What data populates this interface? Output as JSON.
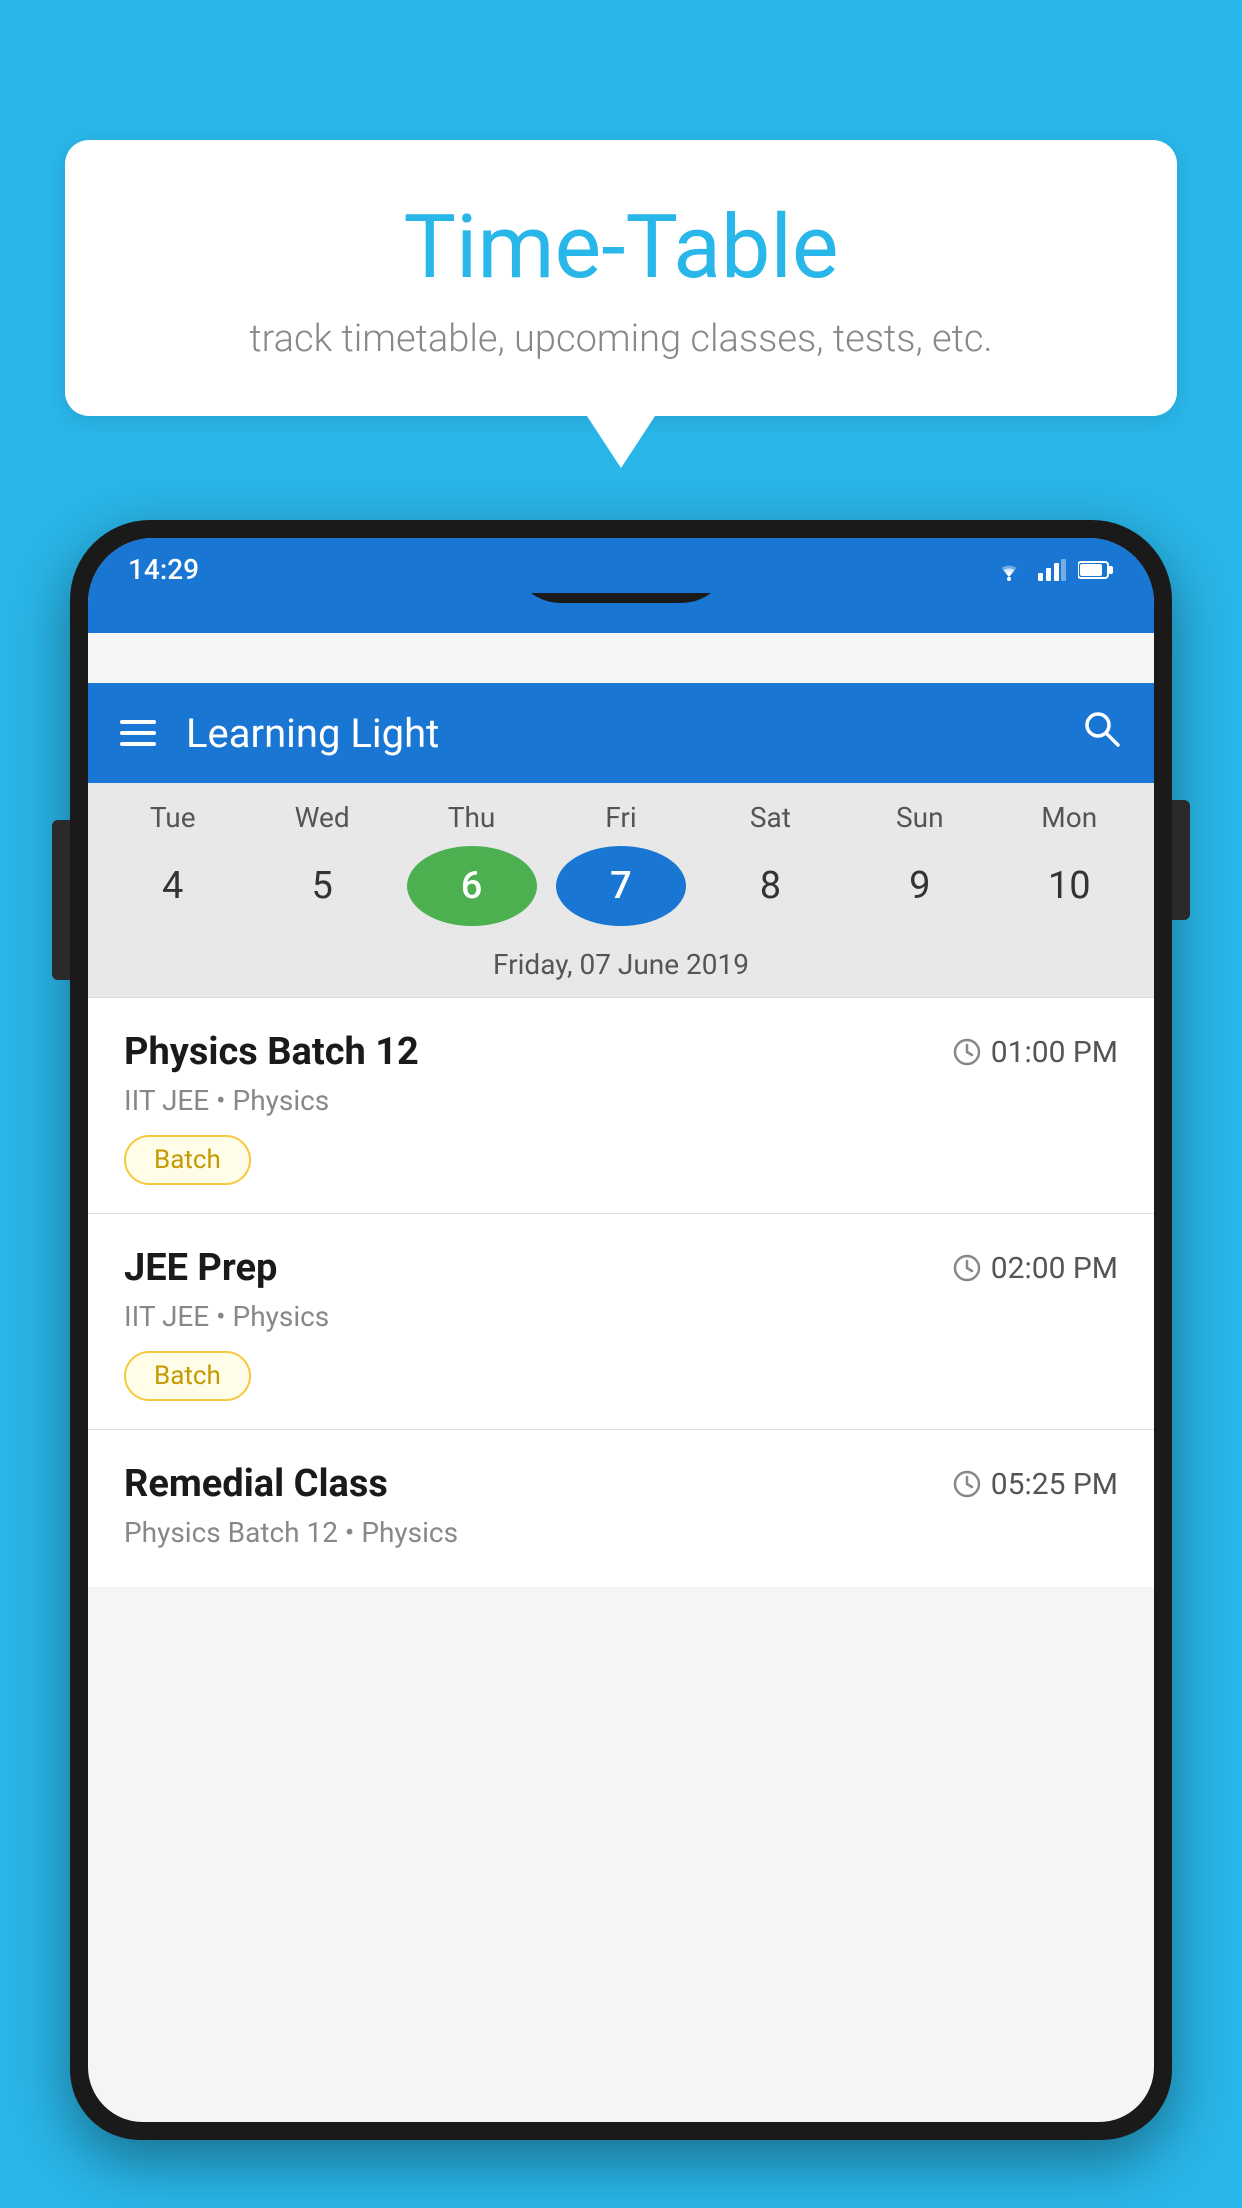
{
  "background_color": "#29b6e8",
  "speech_bubble": {
    "title": "Time-Table",
    "subtitle": "track timetable, upcoming classes, tests, etc."
  },
  "phone": {
    "status_bar": {
      "time": "14:29",
      "icons": [
        "wifi",
        "signal",
        "battery"
      ]
    },
    "app_bar": {
      "title": "Learning Light",
      "menu_icon": "hamburger",
      "search_icon": "search"
    },
    "calendar": {
      "days": [
        {
          "label": "Tue",
          "number": "4"
        },
        {
          "label": "Wed",
          "number": "5"
        },
        {
          "label": "Thu",
          "number": "6",
          "state": "today"
        },
        {
          "label": "Fri",
          "number": "7",
          "state": "selected"
        },
        {
          "label": "Sat",
          "number": "8"
        },
        {
          "label": "Sun",
          "number": "9"
        },
        {
          "label": "Mon",
          "number": "10"
        }
      ],
      "selected_date_label": "Friday, 07 June 2019"
    },
    "schedule": [
      {
        "name": "Physics Batch 12",
        "time": "01:00 PM",
        "details": "IIT JEE • Physics",
        "badge": "Batch"
      },
      {
        "name": "JEE Prep",
        "time": "02:00 PM",
        "details": "IIT JEE • Physics",
        "badge": "Batch"
      },
      {
        "name": "Remedial Class",
        "time": "05:25 PM",
        "details": "Physics Batch 12 • Physics",
        "badge": null
      }
    ]
  }
}
